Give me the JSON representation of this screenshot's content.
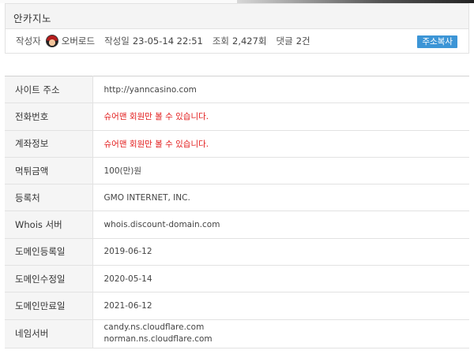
{
  "post": {
    "title": "안카지노",
    "author_label": "작성자",
    "author": "오버로드",
    "date_label": "작성일",
    "date": "23-05-14 22:51",
    "views_label": "조회",
    "views": "2,427회",
    "comments_label": "댓글",
    "comments": "2건",
    "copy_button": "주소복사"
  },
  "info": {
    "rows": [
      {
        "label": "사이트 주소",
        "value": "http://yanncasino.com"
      },
      {
        "label": "전화번호",
        "value": "슈어맨 회원만 볼 수 있습니다."
      },
      {
        "label": "계좌정보",
        "value": "슈어맨 회원만 볼 수 있습니다."
      },
      {
        "label": "먹튀금액",
        "value": "100(만)원"
      },
      {
        "label": "등록처",
        "value": "GMO INTERNET, INC."
      },
      {
        "label": "Whois 서버",
        "value": "whois.discount-domain.com"
      },
      {
        "label": "도메인등록일",
        "value": "2019-06-12"
      },
      {
        "label": "도메인수정일",
        "value": "2020-05-14"
      },
      {
        "label": "도메인만료일",
        "value": "2021-06-12"
      },
      {
        "label": "네임서버",
        "values": [
          "candy.ns.cloudflare.com",
          "norman.ns.cloudflare.com"
        ]
      }
    ]
  },
  "colors": {
    "restricted_text": "#e21a1a",
    "copy_button_bg": "#3c95d6"
  },
  "icons": {
    "avatar": "user-avatar-icon"
  }
}
